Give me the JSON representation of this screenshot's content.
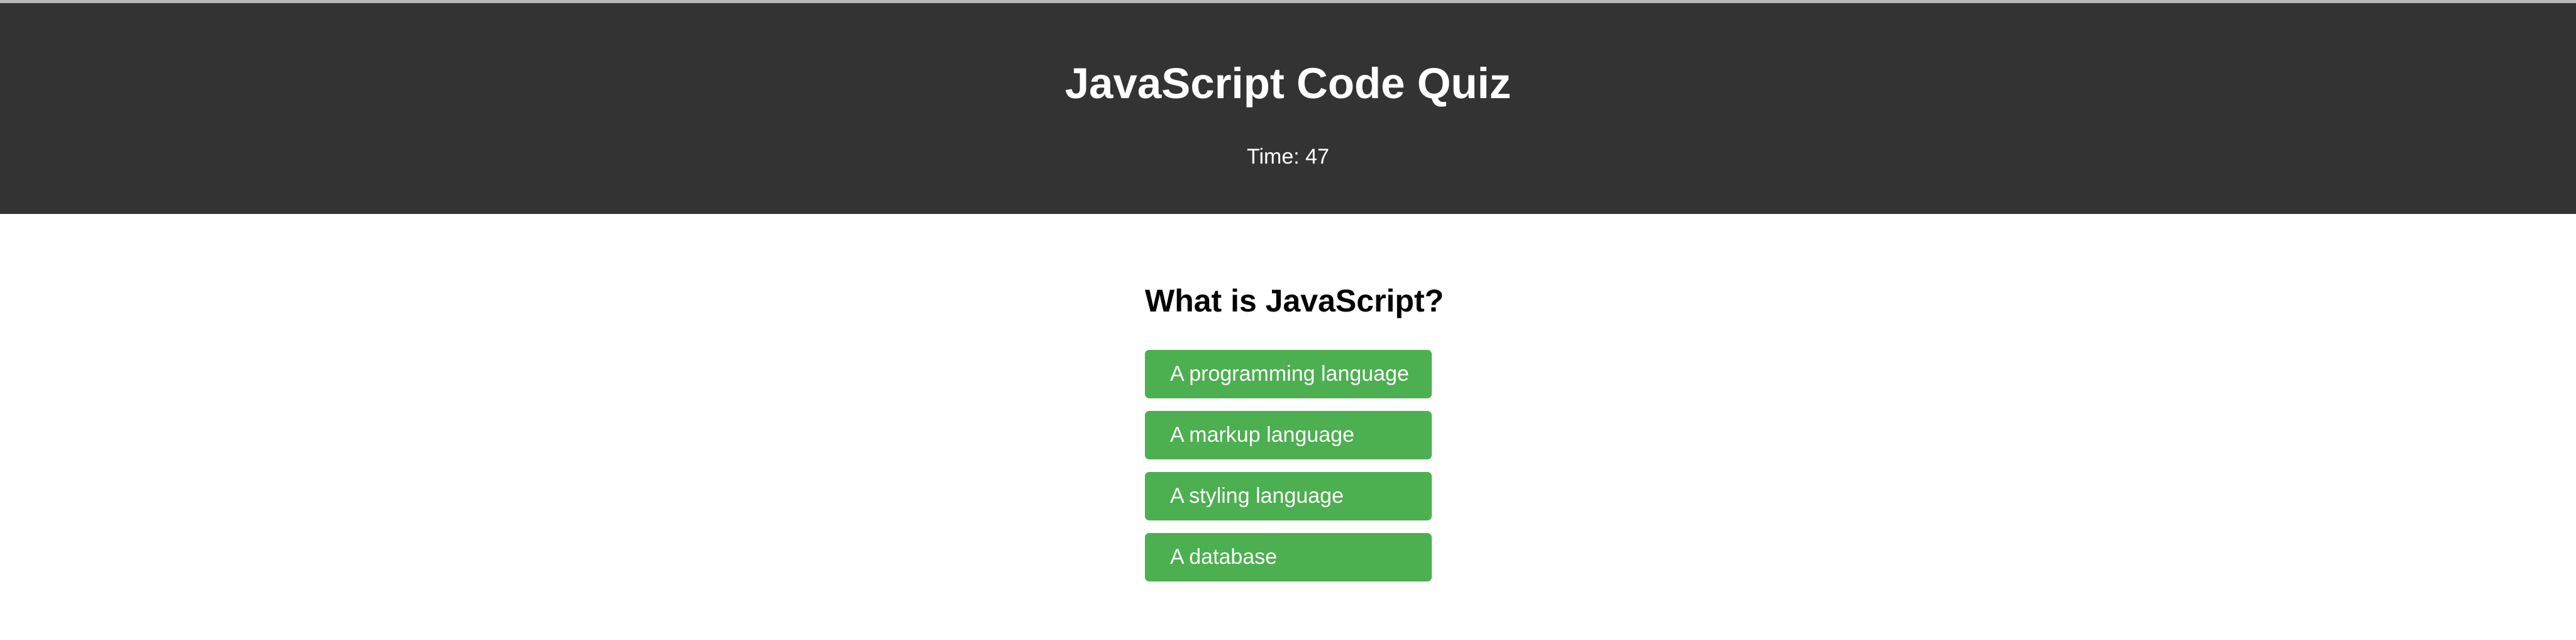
{
  "header": {
    "title": "JavaScript Code Quiz",
    "timer_label": "Time: 47"
  },
  "quiz": {
    "question": "What is JavaScript?",
    "choices": [
      "A programming language",
      "A markup language",
      "A styling language",
      "A database"
    ]
  },
  "colors": {
    "header_bg": "#333333",
    "button_bg": "#4caf50",
    "button_text": "#ffffff"
  }
}
